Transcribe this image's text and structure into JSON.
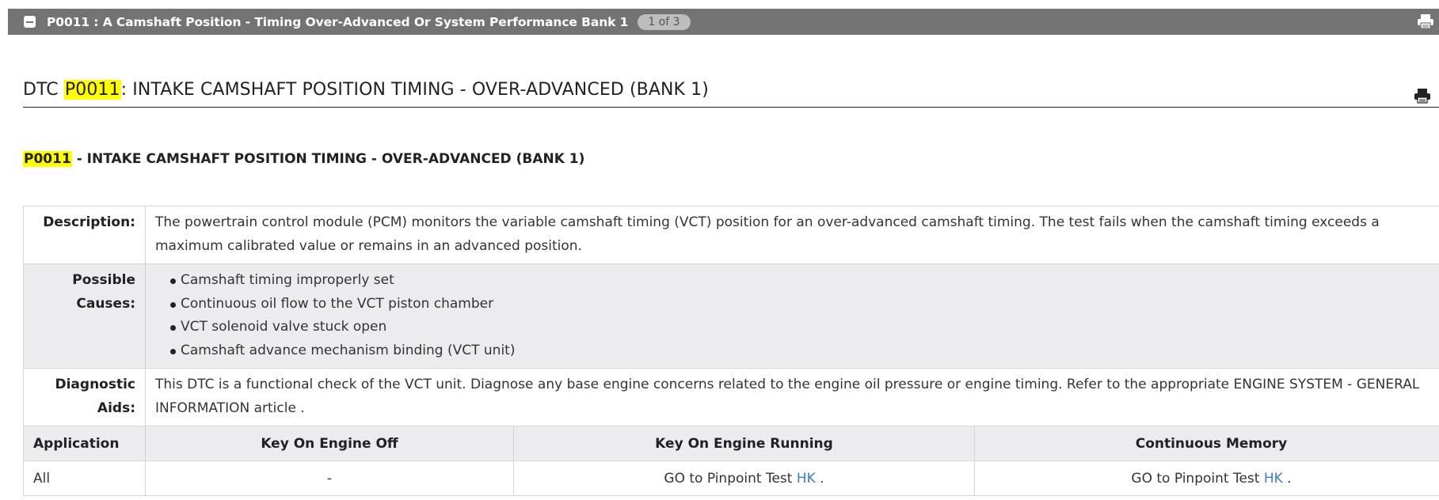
{
  "header": {
    "title": "P0011 : A Camshaft Position - Timing Over-Advanced Or System Performance Bank 1",
    "pager": "1 of 3"
  },
  "heading": {
    "prefix": "DTC ",
    "code": "P0011",
    "suffix": ": INTAKE CAMSHAFT POSITION TIMING - OVER-ADVANCED (BANK 1)"
  },
  "subheading": {
    "code": "P0011",
    "suffix": " - INTAKE CAMSHAFT POSITION TIMING - OVER-ADVANCED (BANK 1)"
  },
  "info": {
    "description_label": "Description:",
    "description": "The powertrain control module (PCM) monitors the variable camshaft timing (VCT) position for an over-advanced camshaft timing. The test fails when the camshaft timing exceeds a maximum calibrated value or remains in an advanced position.",
    "causes_label": "Possible Causes:",
    "causes": [
      "Camshaft timing improperly set",
      "Continuous oil flow to the VCT piston chamber",
      "VCT solenoid valve stuck open",
      "Camshaft advance mechanism binding (VCT unit)"
    ],
    "aids_label": "Diagnostic Aids:",
    "aids": "This DTC is a functional check of the VCT unit. Diagnose any base engine concerns related to the engine oil pressure or engine timing. Refer to the appropriate ENGINE SYSTEM - GENERAL INFORMATION article ."
  },
  "application": {
    "headers": [
      "Application",
      "Key On Engine Off",
      "Key On Engine Running",
      "Continuous Memory"
    ],
    "row": {
      "application": "All",
      "koeo": "-",
      "koer_prefix": "GO to Pinpoint Test ",
      "koer_link": "HK",
      "koer_suffix": " .",
      "cm_prefix": "GO to Pinpoint Test ",
      "cm_link": "HK",
      "cm_suffix": " ."
    }
  },
  "icons": {
    "collapse": "minus-square-icon",
    "print": "printer-icon"
  },
  "colors": {
    "header_bar": "#737373",
    "highlight": "#ffff00",
    "link": "#3a7fbf",
    "row_shade": "#ececee"
  }
}
